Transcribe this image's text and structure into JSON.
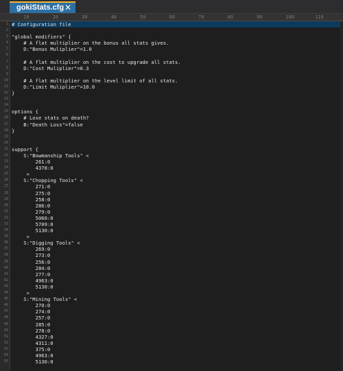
{
  "tab": {
    "title": "gokiStats.cfg",
    "close": "✕"
  },
  "ruler": [
    "10",
    "20",
    "30",
    "40",
    "50",
    "60",
    "70",
    "80",
    "90",
    "100",
    "110"
  ],
  "lines": [
    "# Configuration file",
    "",
    "\"global modifiers\" {",
    "    # A flat multiplier on the bonus all stats gives.",
    "    D:\"Bonus Muliplier\"=1.0",
    "",
    "    # A flat multiplier on the cost to upgrade all stats.",
    "    D:\"Cost Muliplier\"=0.3",
    "",
    "    # A flat multiplier on the level limit of all stats.",
    "    D:\"Limit Muliplier\"=10.0",
    "}",
    "",
    "",
    "options {",
    "    # Lose stats on death?",
    "    B:\"Death Loss\"=false",
    "}",
    "",
    "",
    "support {",
    "    S:\"Bowmanship Tools\" <",
    "        261:0",
    "        4378:0",
    "     >",
    "    S:\"Chopping Tools\" <",
    "        271:0",
    "        275:0",
    "        258:0",
    "        286:0",
    "        279:0",
    "        5060:0",
    "        5709:0",
    "        5130:0",
    "     >",
    "    S:\"Digging Tools\" <",
    "        269:0",
    "        273:0",
    "        256:0",
    "        284:0",
    "        277:0",
    "        4963:0",
    "        5130:0",
    "     >",
    "    S:\"Mining Tools\" <",
    "        270:0",
    "        274:0",
    "        257:0",
    "        285:0",
    "        278:0",
    "        4327:0",
    "        4311:0",
    "        375:0",
    "        4963:0",
    "        5130:0"
  ],
  "colors": {
    "tab_accent": "#f3b431",
    "tab_bg": "#2d6fa3",
    "editor_bg": "#1e1e1e"
  }
}
